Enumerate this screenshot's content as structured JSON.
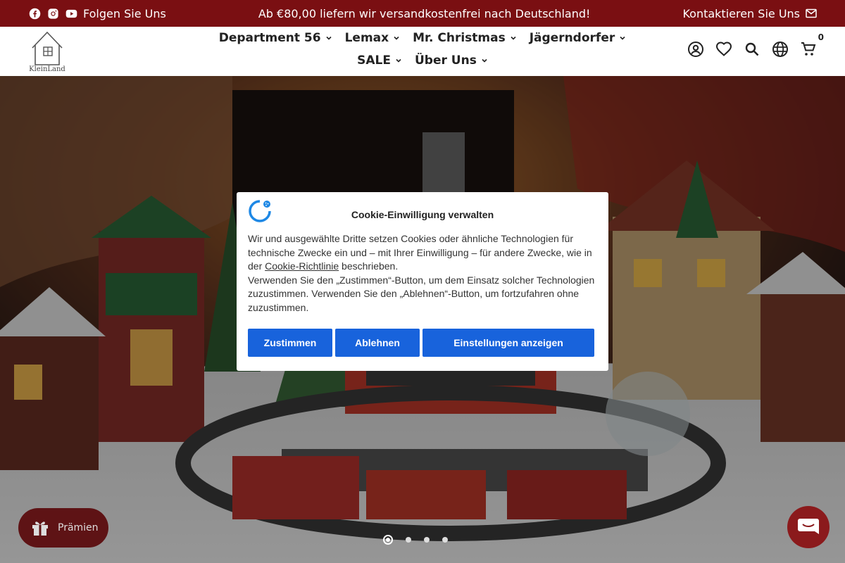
{
  "announcement": {
    "follow_label": "Folgen Sie Uns",
    "message": "Ab €80,00 liefern wir versandkostenfrei nach Deutschland!",
    "contact_label": "Kontaktieren Sie Uns",
    "background": "#7a0f12"
  },
  "header": {
    "logo_text": "KleinLand",
    "nav": [
      {
        "label": "Department 56"
      },
      {
        "label": "Lemax"
      },
      {
        "label": "Mr. Christmas"
      },
      {
        "label": "Jägerndorfer"
      },
      {
        "label": "SALE"
      },
      {
        "label": "Über Uns"
      }
    ],
    "icons": [
      "account-icon",
      "wishlist-icon",
      "search-icon",
      "language-icon",
      "cart-icon"
    ],
    "cart_count": "0"
  },
  "slider": {
    "slides": 4,
    "active": 1
  },
  "cookie": {
    "title": "Cookie-Einwilligung verwalten",
    "text_before_link": "Wir und ausgewählte Dritte setzen Cookies oder ähnliche Technologien für technische Zwecke ein und – mit Ihrer Einwilligung – für andere Zwecke, wie in der ",
    "link_label": "Cookie-Richtlinie",
    "text_after_link": " beschrieben.",
    "text_2": "Verwenden Sie den „Zustimmen“-Button, um dem Einsatz solcher Technologien zuzustimmen. Verwenden Sie den „Ablehnen“-Button, um fortzufahren ohne zuzustimmen.",
    "accept_label": "Zustimmen",
    "reject_label": "Ablehnen",
    "settings_label": "Einstellungen anzeigen",
    "button_color": "#1863dc"
  },
  "rewards": {
    "label": "Prämien"
  },
  "chat": {
    "icon": "chat-icon"
  }
}
